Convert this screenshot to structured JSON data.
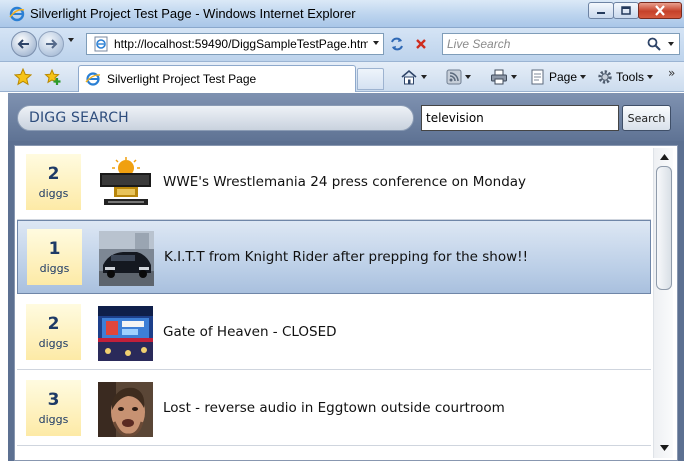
{
  "window": {
    "title": "Silverlight Project Test Page - Windows Internet Explorer"
  },
  "addressbar": {
    "url": "http://localhost:59490/DiggSampleTestPage.htm",
    "live_search_placeholder": "Live Search"
  },
  "tabbar": {
    "tab_title": "Silverlight Project Test Page",
    "page_label": "Page",
    "tools_label": "Tools",
    "more_glyph": "»"
  },
  "app": {
    "brand": "DIGG SEARCH",
    "topic_value": "television",
    "search_button": "Search",
    "stories": [
      {
        "diggs": "2",
        "diggs_label": "diggs",
        "title": "WWE's Wrestlemania 24 press conference on Monday",
        "thumbnail": "wrestlemania-logo"
      },
      {
        "diggs": "1",
        "diggs_label": "diggs",
        "title": "K.I.T.T from Knight Rider after prepping for the show!!",
        "thumbnail": "black-car-photo"
      },
      {
        "diggs": "2",
        "diggs_label": "diggs",
        "title": "Gate of Heaven - CLOSED",
        "thumbnail": "stage-photo"
      },
      {
        "diggs": "3",
        "diggs_label": "diggs",
        "title": "Lost - reverse audio in Eggtown outside courtroom",
        "thumbnail": "face-photo"
      }
    ],
    "selected_index": 1
  },
  "colors": {
    "brand_text": "#2d4c7c",
    "app_background": "#5c7091",
    "digg_box": "#fdeaa6",
    "selection": "#b9cde6"
  }
}
